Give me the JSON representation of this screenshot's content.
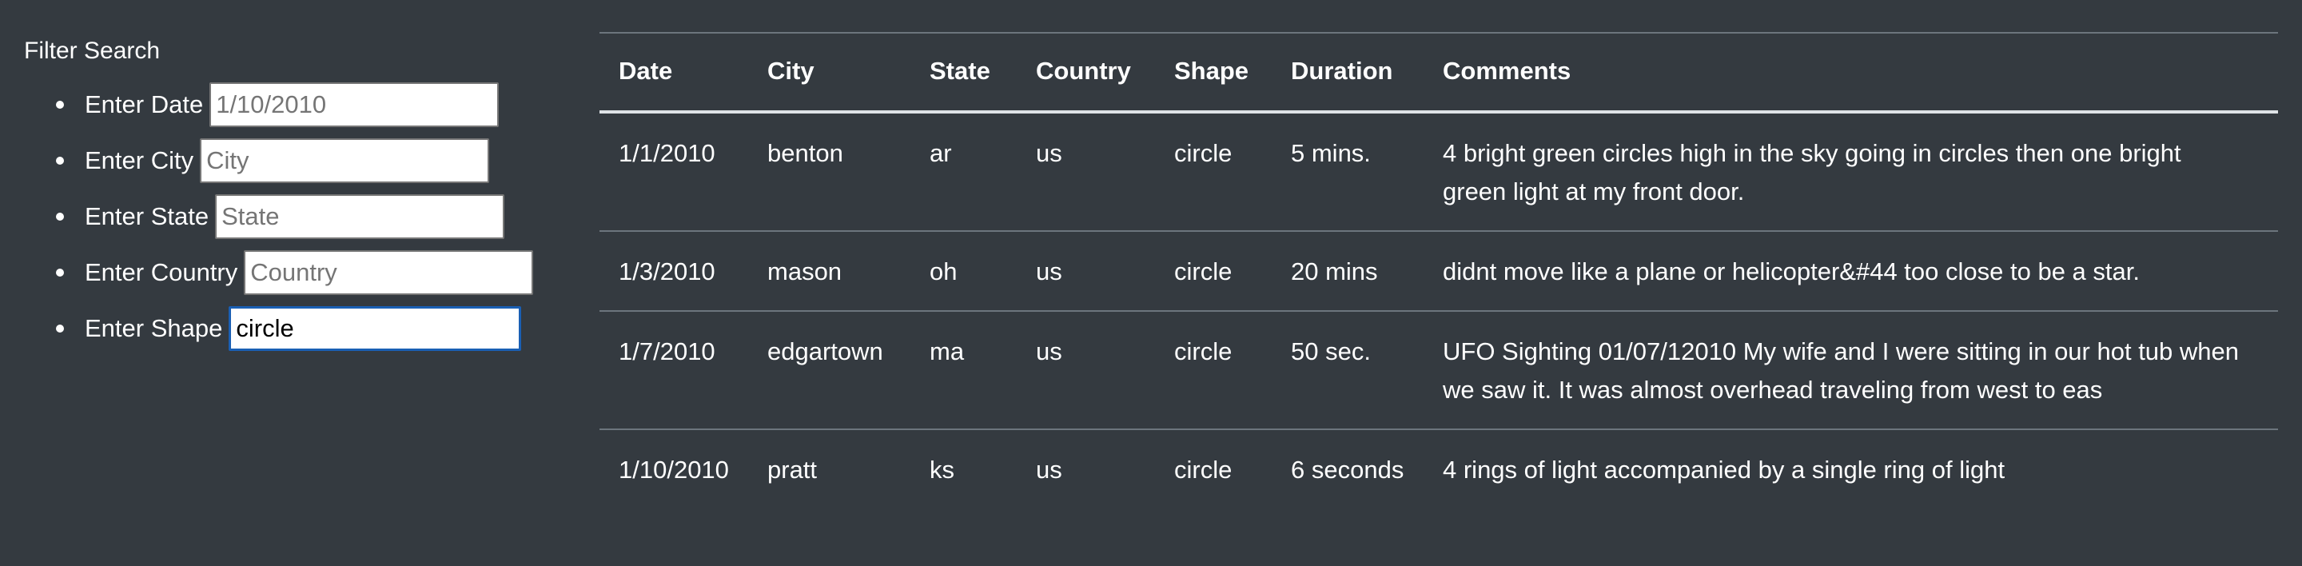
{
  "filter": {
    "title": "Filter Search",
    "fields": [
      {
        "label": "Enter Date",
        "value": "",
        "placeholder": "1/10/2010"
      },
      {
        "label": "Enter City",
        "value": "",
        "placeholder": "City"
      },
      {
        "label": "Enter State",
        "value": "",
        "placeholder": "State"
      },
      {
        "label": "Enter Country",
        "value": "",
        "placeholder": "Country"
      },
      {
        "label": "Enter Shape",
        "value": "circle",
        "placeholder": ""
      }
    ]
  },
  "table": {
    "headers": [
      "Date",
      "City",
      "State",
      "Country",
      "Shape",
      "Duration",
      "Comments"
    ],
    "rows": [
      {
        "date": "1/1/2010",
        "city": "benton",
        "state": "ar",
        "country": "us",
        "shape": "circle",
        "duration": "5 mins.",
        "comments": "4 bright green circles high in the sky going in circles then one bright green light at my front door."
      },
      {
        "date": "1/3/2010",
        "city": "mason",
        "state": "oh",
        "country": "us",
        "shape": "circle",
        "duration": "20 mins",
        "comments": "didnt move like a plane or helicopter&#44 too close to be a star."
      },
      {
        "date": "1/7/2010",
        "city": "edgartown",
        "state": "ma",
        "country": "us",
        "shape": "circle",
        "duration": "50 sec.",
        "comments": "UFO Sighting 01/07/12010 My wife and I were sitting in our hot tub when we saw it. It was almost overhead traveling from west to eas"
      },
      {
        "date": "1/10/2010",
        "city": "pratt",
        "state": "ks",
        "country": "us",
        "shape": "circle",
        "duration": "6 seconds",
        "comments": "4 rings of light accompanied by a single ring of light"
      }
    ]
  },
  "colors": {
    "background": "#343a40",
    "text": "#ffffff",
    "focus_border": "#1a5fb4"
  }
}
